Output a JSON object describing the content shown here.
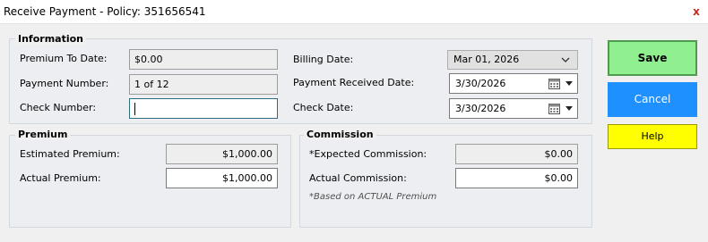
{
  "window": {
    "title": "Receive Payment - Policy: 351656541",
    "close_glyph": "x"
  },
  "information": {
    "title": "Information",
    "premium_to_date_label": "Premium To Date:",
    "premium_to_date_value": "$0.00",
    "payment_number_label": "Payment Number:",
    "payment_number_value": "1 of 12",
    "check_number_label": "Check Number:",
    "check_number_value": "",
    "billing_date_label": "Billing Date:",
    "billing_date_value": "Mar 01, 2026",
    "payment_received_date_label": "Payment Received Date:",
    "payment_received_date_value": "3/30/2026",
    "check_date_label": "Check Date:",
    "check_date_value": "3/30/2026"
  },
  "premium": {
    "title": "Premium",
    "estimated_label": "Estimated Premium:",
    "estimated_value": "$1,000.00",
    "actual_label": "Actual Premium:",
    "actual_value": "$1,000.00"
  },
  "commission": {
    "title": "Commission",
    "expected_label": "*Expected Commission:",
    "expected_value": "$0.00",
    "actual_label": "Actual Commission:",
    "actual_value": "$0.00",
    "note": "*Based on ACTUAL Premium"
  },
  "buttons": {
    "save": "Save",
    "cancel": "Cancel",
    "help": "Help"
  },
  "colors": {
    "save": "#90f090",
    "cancel": "#1e90ff",
    "help": "#ffff00",
    "close": "#c42b1c"
  },
  "icons": {
    "billing_dropdown": "chevron-down-icon",
    "date_picker": "calendar-icon"
  }
}
